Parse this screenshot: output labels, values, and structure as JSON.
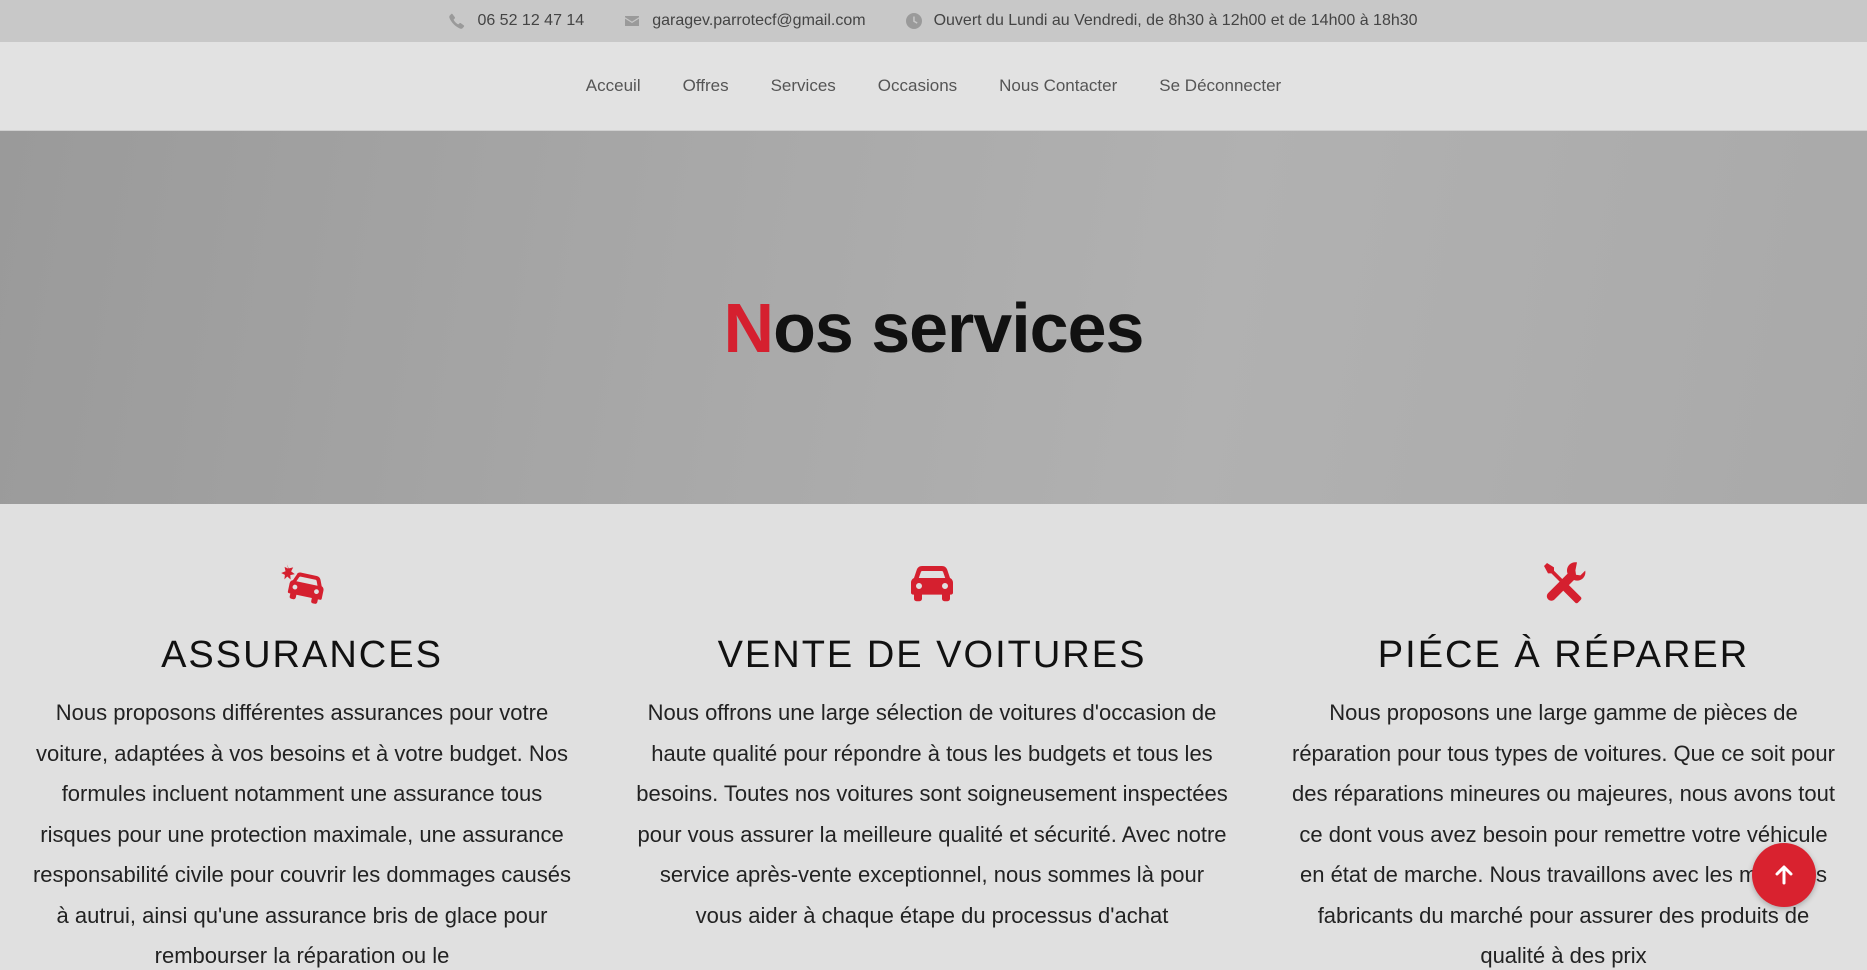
{
  "topbar": {
    "phone": "06 52 12 47 14",
    "email": "garagev.parrotecf@gmail.com",
    "hours": "Ouvert du Lundi au Vendredi, de 8h30 à 12h00 et de 14h00 à 18h30",
    "icons": [
      "phone-icon",
      "envelope-icon",
      "clock-icon"
    ]
  },
  "nav": {
    "items": [
      {
        "label": "Acceuil"
      },
      {
        "label": "Offres"
      },
      {
        "label": "Services"
      },
      {
        "label": "Occasions"
      },
      {
        "label": "Nous Contacter"
      },
      {
        "label": "Se Déconnecter"
      }
    ]
  },
  "hero": {
    "title_accent": "N",
    "title_rest": "os services"
  },
  "services": [
    {
      "icon": "car-crash-icon",
      "title": "ASSURANCES",
      "text": "Nous proposons différentes assurances pour votre voiture, adaptées à vos besoins et à votre budget. Nos formules incluent notamment une assurance tous risques pour une protection maximale, une assurance responsabilité civile pour couvrir les dommages causés à autrui, ainsi qu'une assurance bris de glace pour rembourser la réparation ou le"
    },
    {
      "icon": "car-icon",
      "title": "VENTE DE VOITURES",
      "text": "Nous offrons une large sélection de voitures d'occasion de haute qualité pour répondre à tous les budgets et tous les besoins. Toutes nos voitures sont soigneusement inspectées pour vous assurer la meilleure qualité et sécurité. Avec notre service après-vente exceptionnel, nous sommes là pour vous aider à chaque étape du processus d'achat"
    },
    {
      "icon": "tools-icon",
      "title": "PIÉCE À RÉPARER",
      "text": "Nous proposons une large gamme de pièces de réparation pour tous types de voitures. Que ce soit pour des réparations mineures ou majeures, nous avons tout ce dont vous avez besoin pour remettre votre véhicule en état de marche. Nous travaillons avec les meilleurs fabricants du marché pour assurer des produits de qualité à des prix"
    }
  ],
  "colors": {
    "accent": "#d5202f",
    "topbar_bg": "#c8c8c8",
    "nav_bg": "#e2e2e2",
    "page_bg": "#e0e0e0"
  },
  "scroll_top": {
    "icon": "arrow-up-icon"
  }
}
